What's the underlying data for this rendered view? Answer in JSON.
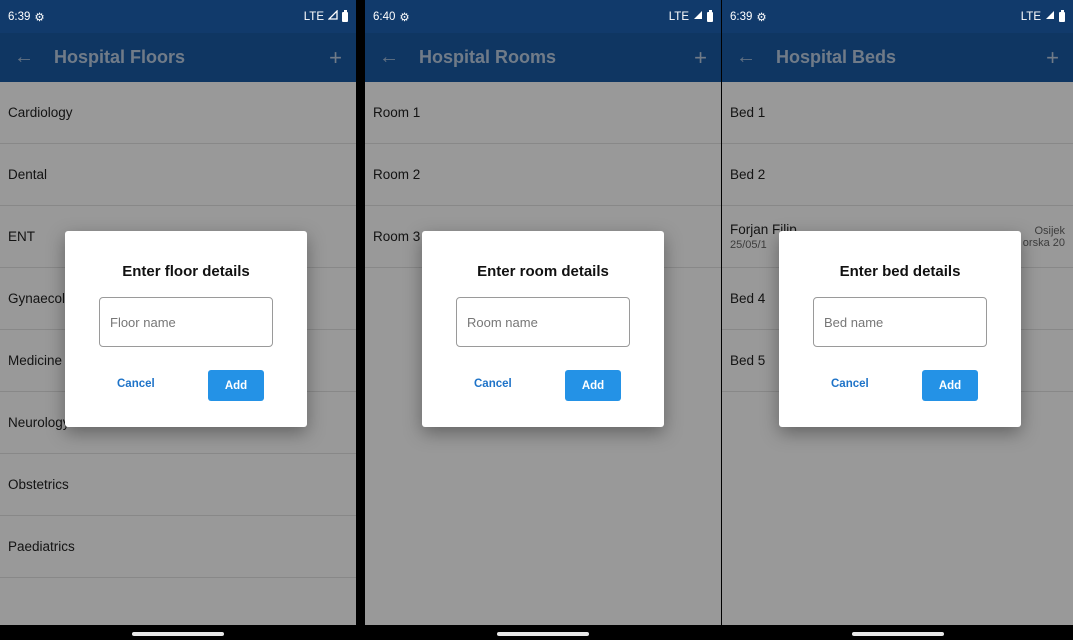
{
  "screens": [
    {
      "status": {
        "time": "6:39",
        "network": "LTE"
      },
      "title": "Hospital Floors",
      "items": [
        "Cardiology",
        "Dental",
        "ENT",
        "Gynaecology",
        "Medicine",
        "Neurology",
        "Obstetrics",
        "Paediatrics"
      ],
      "dialog": {
        "title": "Enter floor details",
        "placeholder": "Floor name",
        "cancel": "Cancel",
        "add": "Add"
      }
    },
    {
      "status": {
        "time": "6:40",
        "network": "LTE"
      },
      "title": "Hospital Rooms",
      "items": [
        "Room 1",
        "Room 2",
        "Room 3"
      ],
      "dialog": {
        "title": "Enter room details",
        "placeholder": "Room name",
        "cancel": "Cancel",
        "add": "Add"
      }
    },
    {
      "status": {
        "time": "6:39",
        "network": "LTE"
      },
      "title": "Hospital Beds",
      "items": [
        "Bed 1",
        "Bed 2"
      ],
      "patient": {
        "name": "Forjan Filip",
        "date": "25/05/1",
        "city": "Osijek",
        "address": "orska 20"
      },
      "items_after": [
        "Bed 4",
        "Bed 5"
      ],
      "dialog": {
        "title": "Enter bed details",
        "placeholder": "Bed name",
        "cancel": "Cancel",
        "add": "Add"
      }
    }
  ],
  "icons": {
    "back": "arrow-left-icon",
    "add": "plus-icon",
    "settings": "gear-icon",
    "battery": "battery-icon",
    "signal": "signal-icon"
  },
  "colors": {
    "status_bar": "#113a6b",
    "app_bar": "#1a5aa3",
    "accent": "#2492e6"
  }
}
